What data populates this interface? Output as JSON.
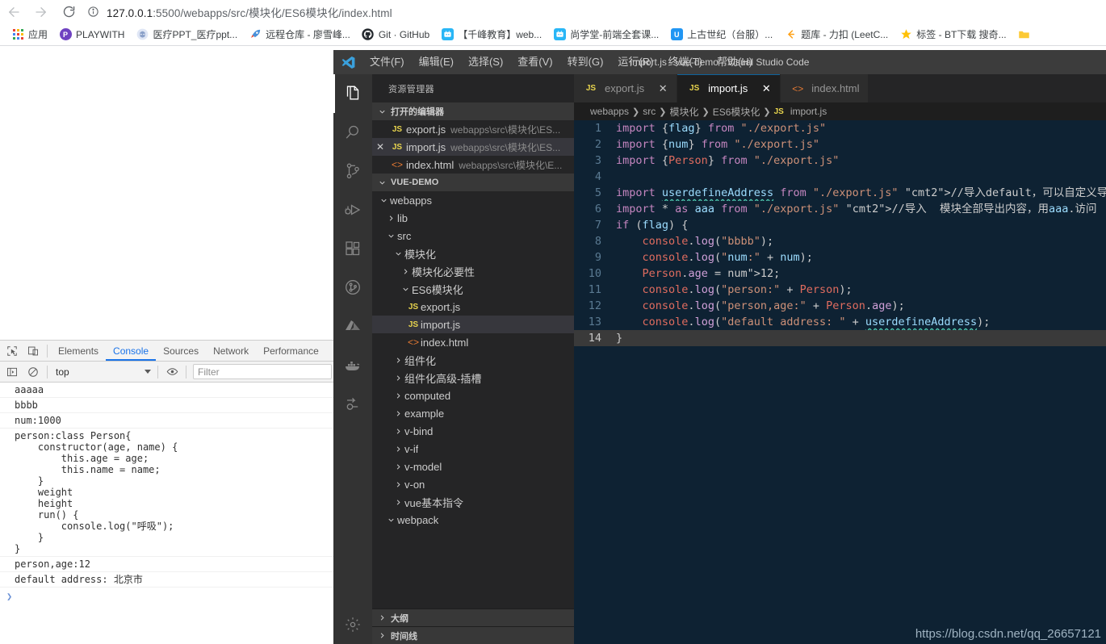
{
  "browser": {
    "back_label": "Back",
    "forward_label": "Forward",
    "reload_label": "Reload",
    "url_domain": "127.0.0.1",
    "url_rest": ":5500/webapps/src/模块化/ES6模块化/index.html",
    "bookmarks": [
      {
        "label": "应用",
        "icon": "apps-grid-icon",
        "color": "#4285f4"
      },
      {
        "label": "PLAYWITH",
        "icon": "playwith-icon",
        "color": "#6f42c1"
      },
      {
        "label": "医疗PPT_医疗ppt...",
        "icon": "medical-icon",
        "color": "#e8eaf6"
      },
      {
        "label": "远程仓库 - 廖雪峰...",
        "icon": "rocket-icon",
        "color": "#ff5722"
      },
      {
        "label": "Git · GitHub",
        "icon": "github-icon",
        "color": "#24292e"
      },
      {
        "label": "【千峰教育】web...",
        "icon": "qianfeng-icon",
        "color": "#29b6f6"
      },
      {
        "label": "尚学堂-前端全套课...",
        "icon": "shangxuetang-icon",
        "color": "#29b6f6"
      },
      {
        "label": "上古世纪（台服）...",
        "icon": "u-icon",
        "color": "#2196f3"
      },
      {
        "label": "题库 - 力扣 (LeetC...",
        "icon": "leetcode-icon",
        "color": "#ffa116"
      },
      {
        "label": "标签 - BT下载 搜奇...",
        "icon": "bt-icon",
        "color": "#ffc107"
      }
    ]
  },
  "devtools": {
    "tabs": [
      {
        "label": "Elements",
        "active": false
      },
      {
        "label": "Console",
        "active": true
      },
      {
        "label": "Sources",
        "active": false
      },
      {
        "label": "Network",
        "active": false
      },
      {
        "label": "Performance",
        "active": false
      }
    ],
    "context_value": "top",
    "filter_placeholder": "Filter",
    "console_rows": [
      "aaaaa",
      "bbbb",
      "num:1000",
      "person:class Person{\n    constructor(age, name) {\n        this.age = age;\n        this.name = name;\n    }\n    weight\n    height\n    run() {\n        console.log(\"呼吸\");\n    }\n}",
      "person,age:12",
      "default address: 北京市"
    ],
    "prompt_symbol": "❯"
  },
  "vscode": {
    "window_title": "import.js - vue-demo - Visual Studio Code",
    "menu": [
      "文件(F)",
      "编辑(E)",
      "选择(S)",
      "查看(V)",
      "转到(G)",
      "运行(R)",
      "终端(T)",
      "帮助(H)"
    ],
    "activitybar": [
      {
        "name": "explorer-icon",
        "active": true
      },
      {
        "name": "search-icon",
        "active": false
      },
      {
        "name": "source-control-icon",
        "active": false
      },
      {
        "name": "run-and-debug-icon",
        "active": false
      },
      {
        "name": "extensions-icon",
        "active": false
      },
      {
        "name": "gitlens-icon",
        "active": false
      },
      {
        "name": "azure-icon",
        "active": false
      },
      {
        "name": "docker-icon",
        "active": false
      },
      {
        "name": "live-share-icon",
        "active": false
      },
      {
        "name": "settings-gear-icon",
        "active": false
      }
    ],
    "sidebar": {
      "title": "资源管理器",
      "open_editors_title": "打开的编辑器",
      "open_editors": [
        {
          "name": "export.js",
          "path": "webapps\\src\\模块化\\ES...",
          "icon": "js",
          "dirty": false,
          "selected": false
        },
        {
          "name": "import.js",
          "path": "webapps\\src\\模块化\\ES...",
          "icon": "js",
          "dirty": true,
          "selected": true
        },
        {
          "name": "index.html",
          "path": "webapps\\src\\模块化\\E...",
          "icon": "html",
          "dirty": false,
          "selected": false
        }
      ],
      "project_title": "VUE-DEMO",
      "tree": [
        {
          "label": "webapps",
          "depth": 1,
          "type": "folder",
          "expanded": true,
          "selected": false
        },
        {
          "label": "lib",
          "depth": 2,
          "type": "folder",
          "expanded": false,
          "selected": false
        },
        {
          "label": "src",
          "depth": 2,
          "type": "folder",
          "expanded": true,
          "selected": false
        },
        {
          "label": "模块化",
          "depth": 3,
          "type": "folder",
          "expanded": true,
          "selected": false
        },
        {
          "label": "模块化必要性",
          "depth": 4,
          "type": "folder",
          "expanded": false,
          "selected": false
        },
        {
          "label": "ES6模块化",
          "depth": 4,
          "type": "folder",
          "expanded": true,
          "selected": false
        },
        {
          "label": "export.js",
          "depth": 5,
          "type": "js",
          "expanded": false,
          "selected": false
        },
        {
          "label": "import.js",
          "depth": 5,
          "type": "js",
          "expanded": false,
          "selected": true
        },
        {
          "label": "index.html",
          "depth": 5,
          "type": "html",
          "expanded": false,
          "selected": false
        },
        {
          "label": "组件化",
          "depth": 3,
          "type": "folder",
          "expanded": false,
          "selected": false
        },
        {
          "label": "组件化高级-插槽",
          "depth": 3,
          "type": "folder",
          "expanded": false,
          "selected": false
        },
        {
          "label": "computed",
          "depth": 3,
          "type": "folder",
          "expanded": false,
          "selected": false
        },
        {
          "label": "example",
          "depth": 3,
          "type": "folder",
          "expanded": false,
          "selected": false
        },
        {
          "label": "v-bind",
          "depth": 3,
          "type": "folder",
          "expanded": false,
          "selected": false
        },
        {
          "label": "v-if",
          "depth": 3,
          "type": "folder",
          "expanded": false,
          "selected": false
        },
        {
          "label": "v-model",
          "depth": 3,
          "type": "folder",
          "expanded": false,
          "selected": false
        },
        {
          "label": "v-on",
          "depth": 3,
          "type": "folder",
          "expanded": false,
          "selected": false
        },
        {
          "label": "vue基本指令",
          "depth": 3,
          "type": "folder",
          "expanded": false,
          "selected": false
        },
        {
          "label": "webpack",
          "depth": 2,
          "type": "folder",
          "expanded": true,
          "selected": false
        }
      ],
      "outline_title": "大纲",
      "timeline_title": "时间线"
    },
    "editor_tabs": [
      {
        "label": "export.js",
        "icon": "js",
        "active": false,
        "closable": true
      },
      {
        "label": "import.js",
        "icon": "js",
        "active": true,
        "closable": true
      },
      {
        "label": "index.html",
        "icon": "html",
        "active": false,
        "closable": false
      }
    ],
    "breadcrumb": [
      "webapps",
      "src",
      "模块化",
      "ES6模块化",
      "import.js"
    ],
    "code": {
      "line_count": 14,
      "current_line": 14,
      "lines": [
        {
          "n": 1,
          "text": "import {flag} from \"./export.js\""
        },
        {
          "n": 2,
          "text": "import {num} from \"./export.js\""
        },
        {
          "n": 3,
          "text": "import {Person} from \"./export.js\""
        },
        {
          "n": 4,
          "text": ""
        },
        {
          "n": 5,
          "text": "import userdefineAddress from \"./export.js\" //导入default，可以自定义导入名"
        },
        {
          "n": 6,
          "text": "import * as aaa from \"./export.js\" //导入  模块全部导出内容，用aaa.访问"
        },
        {
          "n": 7,
          "text": "if (flag) {"
        },
        {
          "n": 8,
          "text": "    console.log(\"bbbb\");"
        },
        {
          "n": 9,
          "text": "    console.log(\"num:\" + num);"
        },
        {
          "n": 10,
          "text": "    Person.age = 12;"
        },
        {
          "n": 11,
          "text": "    console.log(\"person:\" + Person);"
        },
        {
          "n": 12,
          "text": "    console.log(\"person,age:\" + Person.age);"
        },
        {
          "n": 13,
          "text": "    console.log(\"default address: \" + userdefineAddress);"
        },
        {
          "n": 14,
          "text": "}"
        }
      ]
    },
    "watermark": "https://blog.csdn.net/qq_26657121"
  }
}
